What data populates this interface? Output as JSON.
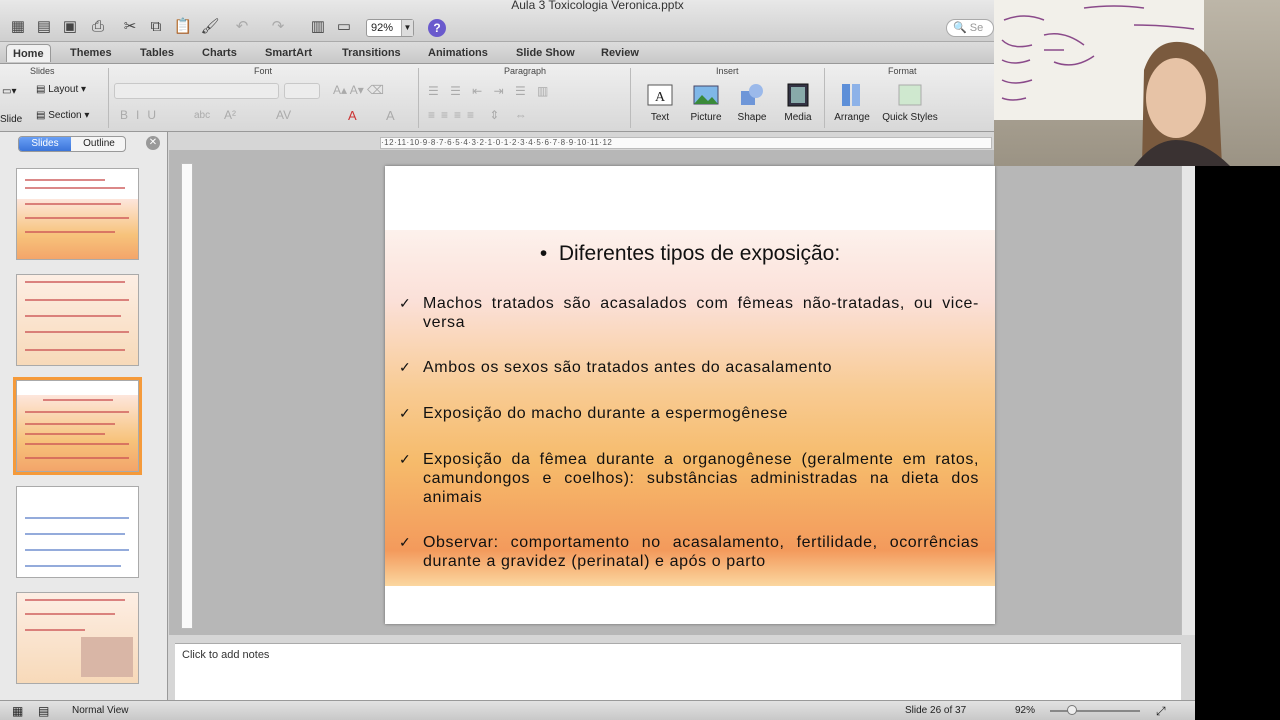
{
  "window": {
    "title": "Aula 3 Toxicologia Veronica.pptx",
    "zoom": "92%",
    "search_placeholder": "Se"
  },
  "tabs": [
    "Home",
    "Themes",
    "Tables",
    "Charts",
    "SmartArt",
    "Transitions",
    "Animations",
    "Slide Show",
    "Review"
  ],
  "ribbon": {
    "groups": {
      "slides": "Slides",
      "font": "Font",
      "paragraph": "Paragraph",
      "insert": "Insert",
      "format": "Format"
    },
    "slides_group": {
      "layout": "Layout",
      "section": "Section",
      "new_slide": "Slide"
    },
    "insert_buttons": [
      "Text",
      "Picture",
      "Shape",
      "Media"
    ],
    "format_buttons": [
      "Arrange",
      "Quick Styles"
    ]
  },
  "sidebar": {
    "segment": [
      "Slides",
      "Outline"
    ]
  },
  "ruler": {
    "h": "·12·11·10·9·8·7·6·5·4·3·2·1·0·1·2·3·4·5·6·7·8·9·10·11·12"
  },
  "slide": {
    "title": "Diferentes tipos de exposição:",
    "bullets": [
      "Machos tratados são acasalados com fêmeas não-tratadas, ou vice-versa",
      "Ambos os sexos são tratados antes do acasalamento",
      "Exposição do macho durante a espermogênese",
      "Exposição da fêmea durante a organogênese (geralmente em ratos, camundongos e coelhos): substâncias administradas na dieta dos animais",
      "Observar: comportamento no acasalamento, fertilidade, ocorrências durante a gravidez (perinatal) e após o parto"
    ],
    "bullet_mark": "•",
    "check_mark": "✓"
  },
  "notes": {
    "placeholder": "Click to add notes"
  },
  "status": {
    "view": "Normal View",
    "slide_position": "Slide 26 of 37",
    "zoom": "92%"
  },
  "colors": {
    "accent_tab": "#3b74d9",
    "selection": "#f59a3a"
  }
}
